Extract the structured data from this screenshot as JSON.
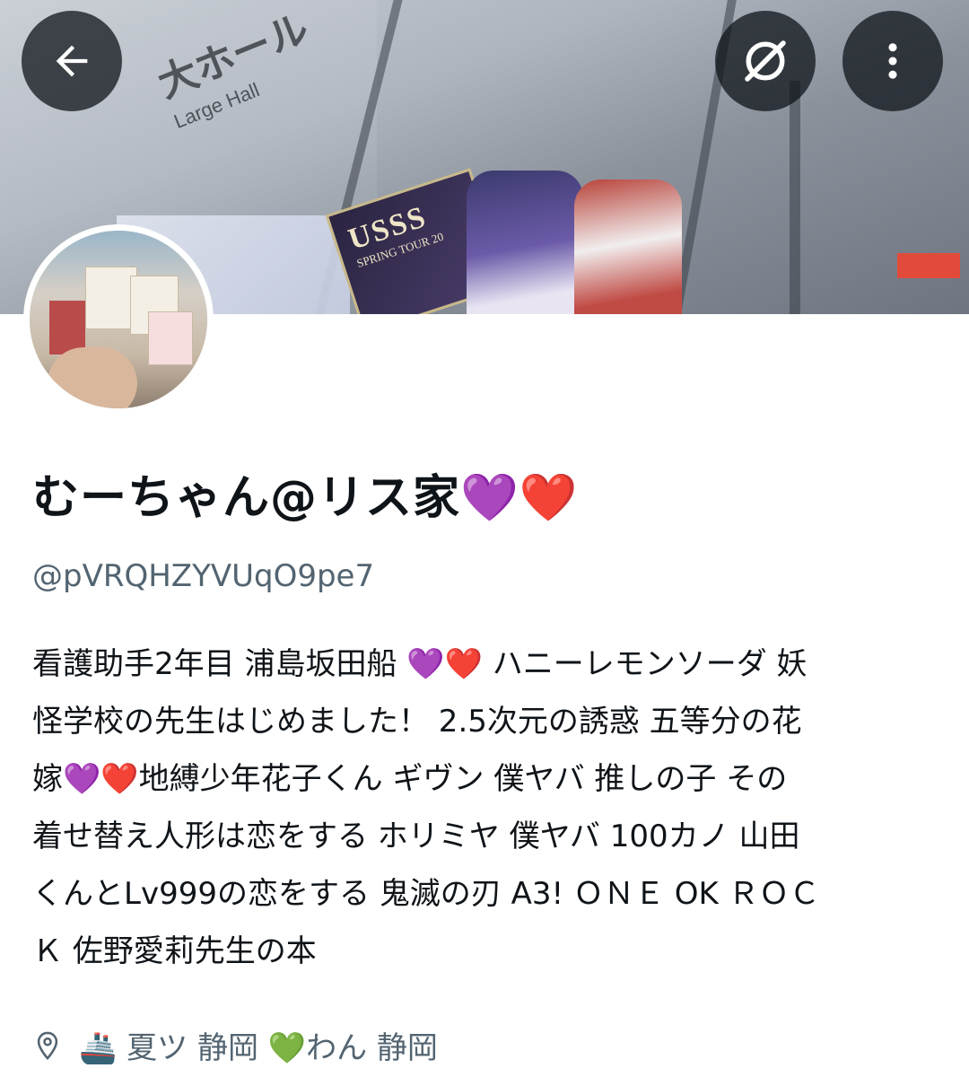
{
  "profile": {
    "display_name": "むーちゃん@リス家💜❤️",
    "handle": "@pVRQHZYVUqO9pe7",
    "bio": "看護助手2年目 浦島坂田船 💜❤️ ハニーレモンソーダ 妖\n怪学校の先生はじめました！ 2.5次元の誘惑 五等分の花\n嫁💜❤️地縛少年花子くん ギヴン 僕ヤバ 推しの子 その\n着せ替え人形は恋をする ホリミヤ 僕ヤバ 100カノ 山田\nくんとLv999の恋をする 鬼滅の刃 A3! ＯＮＥ OK ＲＯＣ\nＫ 佐野愛莉先生の本",
    "location": "🚢 夏ツ 静岡 💚わん 静岡"
  },
  "banner": {
    "sign_text": "大ホール",
    "sign_text_en": "Large Hall",
    "ticket_text": "USSS",
    "ticket_sub": "SPRING TOUR 20"
  },
  "toolbar": {
    "back_icon": "arrow-left-icon",
    "grok_icon": "grok-icon",
    "more_icon": "more-vertical-icon"
  },
  "colors": {
    "overlay_button": "#0f1419",
    "secondary_text": "#536471"
  }
}
